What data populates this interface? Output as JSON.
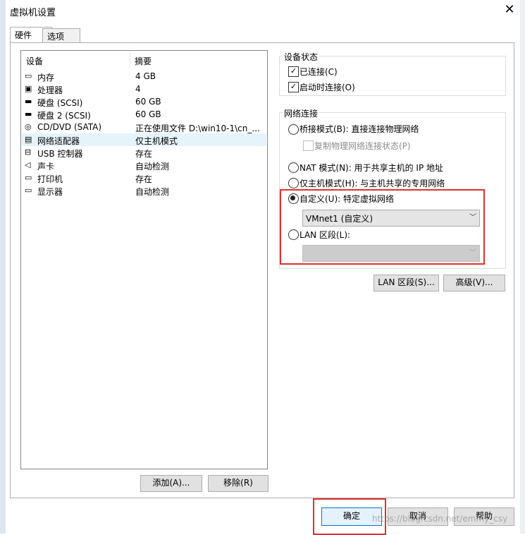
{
  "window": {
    "title": "虚拟机设置"
  },
  "tabs": [
    {
      "label": "硬件"
    },
    {
      "label": "选项"
    }
  ],
  "devices": {
    "col_device": "设备",
    "col_summary": "摘要",
    "rows": [
      {
        "name": "内存",
        "summary": "4 GB",
        "icon": "memory-icon",
        "glyph": "▭"
      },
      {
        "name": "处理器",
        "summary": "4",
        "icon": "processor-icon",
        "glyph": "▣"
      },
      {
        "name": "硬盘 (SCSI)",
        "summary": "60 GB",
        "icon": "hard-disk-icon",
        "glyph": "▬"
      },
      {
        "name": "硬盘 2 (SCSI)",
        "summary": "60 GB",
        "icon": "hard-disk-icon",
        "glyph": "▬"
      },
      {
        "name": "CD/DVD (SATA)",
        "summary": "正在使用文件 D:\\win10-1\\cn_...",
        "icon": "cd-dvd-icon",
        "glyph": "◎"
      },
      {
        "name": "网络适配器",
        "summary": "仅主机模式",
        "icon": "network-adapter-icon",
        "glyph": "▤",
        "selected": true
      },
      {
        "name": "USB 控制器",
        "summary": "存在",
        "icon": "usb-icon",
        "glyph": "⊟"
      },
      {
        "name": "声卡",
        "summary": "自动检测",
        "icon": "sound-icon",
        "glyph": "◁"
      },
      {
        "name": "打印机",
        "summary": "存在",
        "icon": "printer-icon",
        "glyph": "▭"
      },
      {
        "name": "显示器",
        "summary": "自动检测",
        "icon": "monitor-icon",
        "glyph": "▭"
      }
    ],
    "add_button": "添加(A)...",
    "remove_button": "移除(R)"
  },
  "device_status": {
    "title": "设备状态",
    "connected": {
      "label": "已连接(C)",
      "checked": true
    },
    "connect_on_power": {
      "label": "启动时连接(O)",
      "checked": true
    }
  },
  "network": {
    "title": "网络连接",
    "bridged": {
      "label": "桥接模式(B): 直接连接物理网络",
      "selected": false
    },
    "replicate": {
      "label": "复制物理网络连接状态(P)",
      "checked": false,
      "disabled": true
    },
    "nat": {
      "label": "NAT 模式(N): 用于共享主机的 IP 地址",
      "selected": false
    },
    "host_only": {
      "label": "仅主机模式(H): 与主机共享的专用网络",
      "selected": false
    },
    "custom": {
      "label": "自定义(U): 特定虚拟网络",
      "selected": true,
      "value": "VMnet1 (自定义)"
    },
    "lan": {
      "label": "LAN 区段(L):",
      "selected": false,
      "value": ""
    },
    "lan_segments_button": "LAN 区段(S)...",
    "advanced_button": "高级(V)..."
  },
  "footer": {
    "ok": "确定",
    "cancel": "取消",
    "help": "帮助"
  },
  "watermark": "https://blog.csdn.net/emmy_csy",
  "colors": {
    "highlight": "#e0302e",
    "selection": "#e5f3fb"
  }
}
